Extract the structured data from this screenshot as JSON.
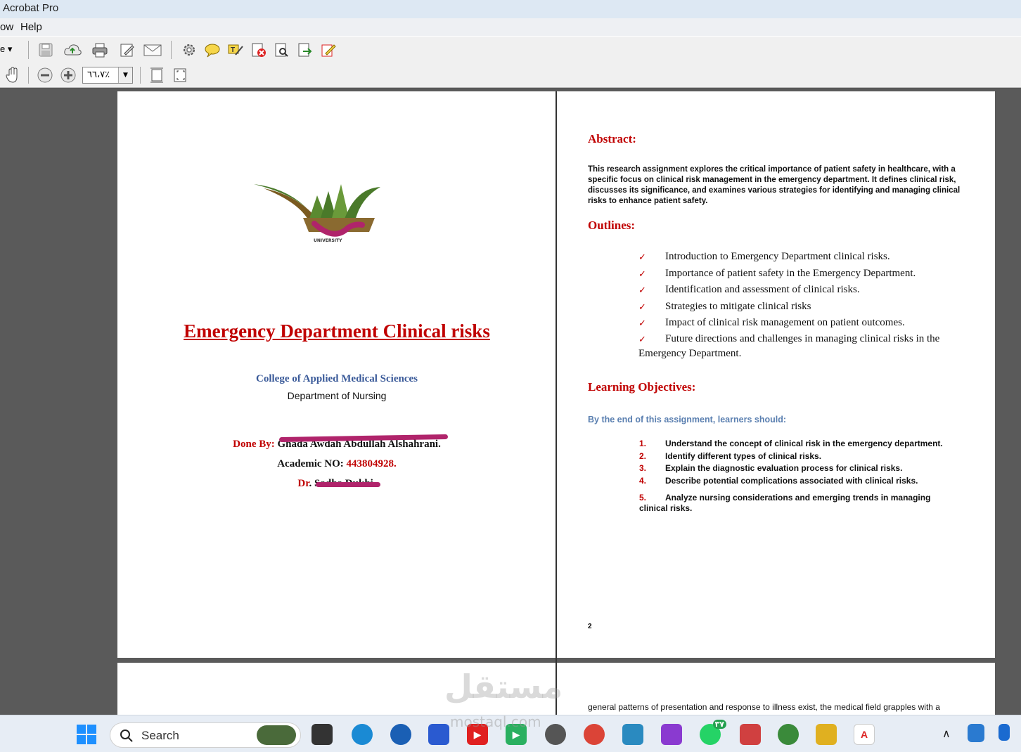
{
  "window": {
    "title": "Acrobat Pro"
  },
  "menu": {
    "items": [
      "ow",
      "Help"
    ]
  },
  "toolbar": {
    "zoom_value": "٦٦،٧٪",
    "left_stub": "e ▾"
  },
  "page1": {
    "logo_caption": "UNIVERSITY",
    "title": "Emergency Department Clinical risks",
    "college": "College of Applied Medical Sciences",
    "department": "Department of Nursing",
    "done_by_label": "Done By:",
    "done_by_name": "Ghada Awdah Abdullah Alshahrani.",
    "academic_label": "Academic NO:",
    "academic_value": "443804928.",
    "dr_label": "Dr",
    "dr_name": ". Sadha Dukhi."
  },
  "page2": {
    "abstract_heading": "Abstract:",
    "abstract_text": "This research assignment explores the critical importance of patient safety in healthcare, with a specific focus on clinical risk management in the emergency department. It defines clinical risk, discusses its significance, and examines various strategies for identifying and managing clinical risks to enhance patient safety.",
    "outlines_heading": "Outlines:",
    "outlines": [
      "Introduction to Emergency Department clinical risks.",
      " Importance of patient safety in the Emergency Department.",
      "Identification and assessment of clinical risks.",
      "Strategies to mitigate clinical risks",
      "Impact of clinical risk management on patient outcomes.",
      "Future directions and challenges in managing clinical risks in the",
      "Emergency Department."
    ],
    "lo_heading": "Learning Objectives:",
    "lo_intro": "By the end of this assignment, learners should:",
    "objectives": [
      {
        "num": "1.",
        "text": "Understand the concept of clinical risk in the emergency department."
      },
      {
        "num": "2.",
        "text": "Identify different types of clinical risks."
      },
      {
        "num": "3.",
        "text": "Explain the diagnostic evaluation process for clinical risks."
      },
      {
        "num": "4.",
        "text": "Describe potential complications associated with clinical risks."
      },
      {
        "num": "5.",
        "text": "Analyze nursing considerations and emerging trends in managing clinical risks."
      }
    ],
    "page_number": "2"
  },
  "page4": {
    "text": "general patterns of presentation and response to illness exist, the medical field grapples with a"
  },
  "watermark": {
    "ar": "مستقل",
    "en": "mostaql.com"
  },
  "taskbar": {
    "search_label": "Search",
    "whatsapp_badge": "٣٧"
  },
  "colors": {
    "heading_red": "#c00000",
    "college_blue": "#3a5a99"
  }
}
